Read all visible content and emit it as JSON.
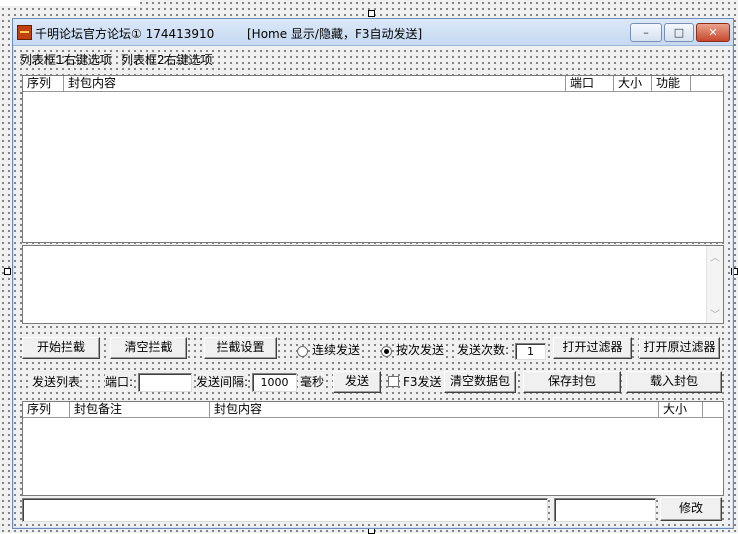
{
  "window": {
    "title": "千明论坛官方论坛① 174413910",
    "hint": "[Home 显示/隐藏，F3自动发送]",
    "controls": {
      "minimize": "–",
      "maximize": "□",
      "close": "✕"
    }
  },
  "menus": [
    "列表框1右键选项",
    "列表框2右键选项"
  ],
  "capture_list": {
    "columns": [
      "序列",
      "封包内容",
      "端口",
      "大小",
      "功能"
    ]
  },
  "editor": {
    "scroll_up": "︿",
    "scroll_down": "﹀"
  },
  "toolbar1": {
    "start_capture": "开始拦截",
    "clear_capture": "清空拦截",
    "capture_settings": "拦截设置",
    "mode_continuous": "连续发送",
    "mode_times": "按次发送",
    "send_count_label": "发送次数:",
    "send_count_value": "1",
    "open_filter": "打开过滤器",
    "open_original_filter": "打开原过滤器"
  },
  "toolbar2": {
    "send_list_label": "发送列表",
    "port_label": "端口:",
    "port_value": "",
    "interval_label": "发送间隔:",
    "interval_value": "1000",
    "ms_label": "毫秒",
    "send": "发送",
    "f3_send": "F3发送",
    "clear_packets": "清空数据包",
    "save_packet": "保存封包",
    "load_packet": "载入封包"
  },
  "send_list": {
    "columns": [
      "序列",
      "封包备注",
      "封包内容",
      "大小"
    ]
  },
  "bottom": {
    "edit_value": "",
    "small_value": "",
    "modify": "修改"
  }
}
